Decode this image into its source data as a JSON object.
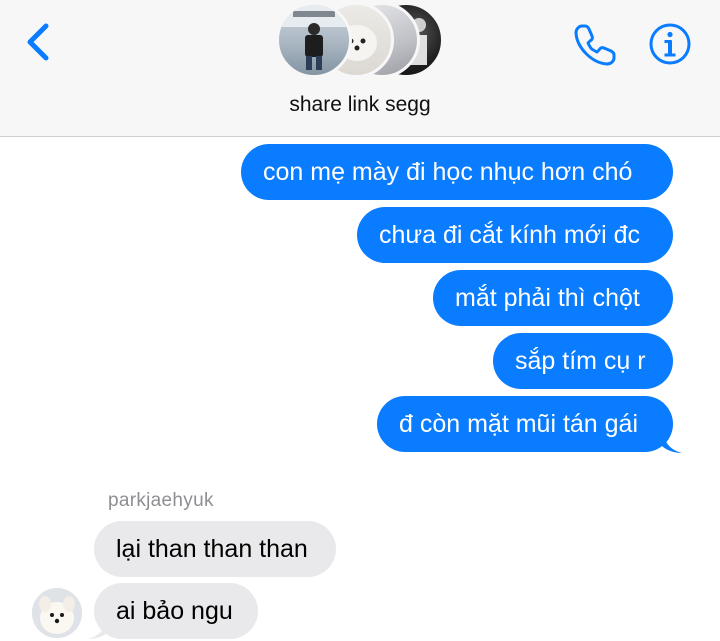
{
  "header": {
    "group_name": "share link segg",
    "back_icon": "chevron-left-icon",
    "call_icon": "phone-icon",
    "info_icon": "info-icon",
    "accent_color": "#0a7cff"
  },
  "messages": [
    {
      "direction": "sent",
      "text": "con mẹ mày đi học nhục hơn chó"
    },
    {
      "direction": "sent",
      "text": "chưa đi cắt kính mới đc"
    },
    {
      "direction": "sent",
      "text": "mắt phải thì chột"
    },
    {
      "direction": "sent",
      "text": "sắp tím cụ r"
    },
    {
      "direction": "sent",
      "text": "đ còn mặt mũi tán gái"
    },
    {
      "direction": "received",
      "sender": "parkjaehyuk",
      "text": "lại than than than"
    },
    {
      "direction": "received",
      "text": "ai bảo ngu"
    }
  ],
  "colors": {
    "sent_bubble": "#0a7cff",
    "received_bubble": "#e9e9eb",
    "header_bg": "#f7f7f8"
  }
}
